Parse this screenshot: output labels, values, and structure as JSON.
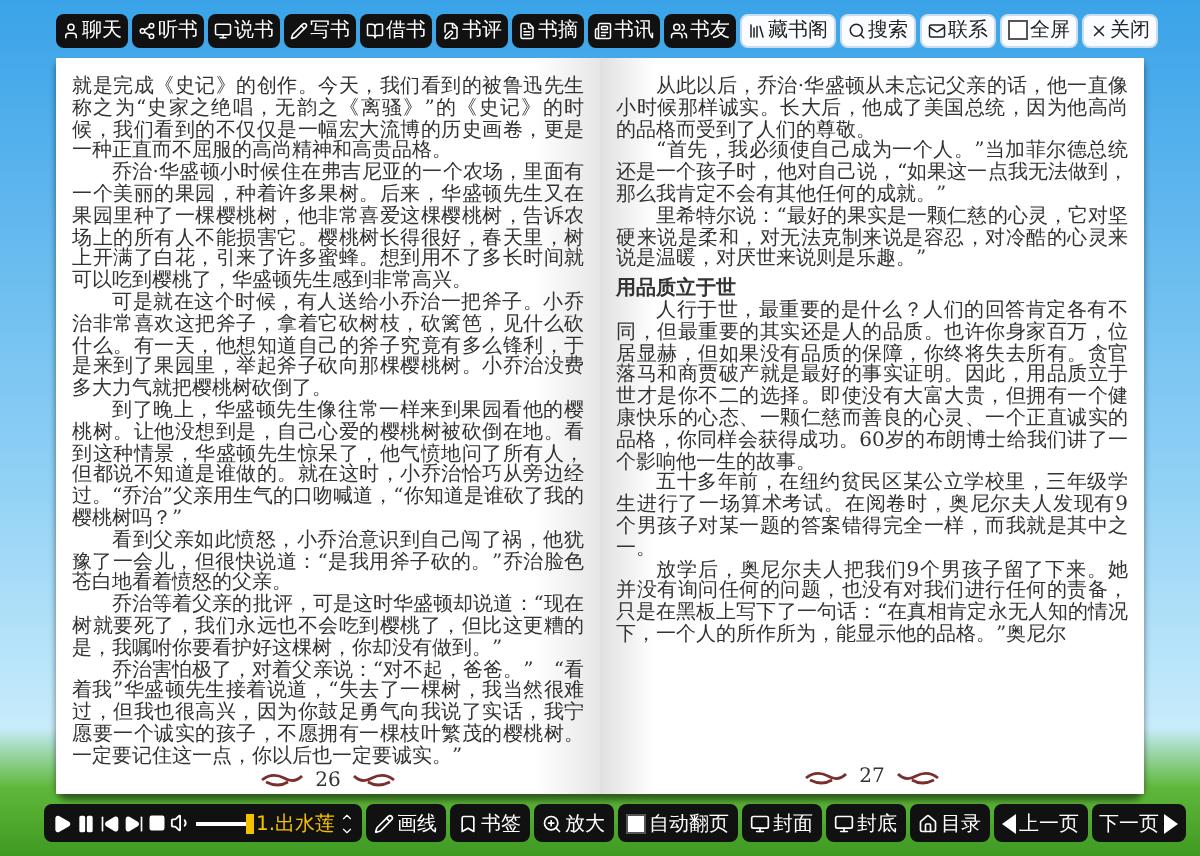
{
  "top_toolbar": {
    "dark_buttons": [
      {
        "label": "聊天"
      },
      {
        "label": "听书"
      },
      {
        "label": "说书"
      },
      {
        "label": "写书"
      },
      {
        "label": "借书"
      },
      {
        "label": "书评"
      },
      {
        "label": "书摘"
      },
      {
        "label": "书讯"
      },
      {
        "label": "书友"
      }
    ],
    "light_buttons": [
      {
        "label": "藏书阁",
        "kind": "button"
      },
      {
        "label": "搜索",
        "kind": "button"
      },
      {
        "label": "联系",
        "kind": "button"
      },
      {
        "label": "全屏",
        "kind": "checkbox",
        "checked": false
      },
      {
        "label": "关闭",
        "kind": "button"
      }
    ]
  },
  "book": {
    "pages": [
      {
        "page_number": "26",
        "paragraphs": [
          {
            "kind": "continuation",
            "text": "就是完成《史记》的创作。今天，我们看到的被鲁迅先生称之为“史家之绝唱，无韵之《离骚》”的《史记》的时候，我们看到的不仅仅是一幅宏大流博的历史画卷，更是一种正直而不屈服的高尚精神和高贵品格。"
          },
          {
            "kind": "body",
            "text": "乔治·华盛顿小时候住在弗吉尼亚的一个农场，里面有一个美丽的果园，种着许多果树。后来，华盛顿先生又在果园里种了一棵樱桃树，他非常喜爱这棵樱桃树，告诉农场上的所有人不能损害它。樱桃树长得很好，春天里，树上开满了白花，引来了许多蜜蜂。想到用不了多长时间就可以吃到樱桃了，华盛顿先生感到非常高兴。"
          },
          {
            "kind": "body",
            "text": "可是就在这个时候，有人送给小乔治一把斧子。小乔治非常喜欢这把斧子，拿着它砍树枝，砍篱笆，见什么砍什么。有一天，他想知道自己的斧子究竟有多么锋利，于是来到了果园里，举起斧子砍向那棵樱桃树。小乔治没费多大力气就把樱桃树砍倒了。"
          },
          {
            "kind": "body",
            "text": "到了晚上，华盛顿先生像往常一样来到果园看他的樱桃树。让他没想到是，自己心爱的樱桃树被砍倒在地。看到这种情景，华盛顿先生惊呆了，他气愤地问了所有人，但都说不知道是谁做的。就在这时，小乔治恰巧从旁边经过。“乔治”父亲用生气的口吻喊道，“你知道是谁砍了我的樱桃树吗？”"
          },
          {
            "kind": "body",
            "text": "看到父亲如此愤怒，小乔治意识到自己闯了祸，他犹豫了一会儿，但很快说道：“是我用斧子砍的。”乔治脸色苍白地看着愤怒的父亲。"
          },
          {
            "kind": "body",
            "text": "乔治等着父亲的批评，可是这时华盛顿却说道：“现在树就要死了，我们永远也不会吃到樱桃了，但比这更糟的是，我嘱咐你要看护好这棵树，你却没有做到。”"
          },
          {
            "kind": "body",
            "text": "乔治害怕极了，对着父亲说：“对不起，爸爸。”　“看着我”华盛顿先生接着说道，“失去了一棵树，我当然很难过，但我也很高兴，因为你鼓足勇气向我说了实话，我宁愿要一个诚实的孩子，不愿拥有一棵枝叶繁茂的樱桃树。一定要记住这一点，你以后也一定要诚实。”"
          }
        ]
      },
      {
        "page_number": "27",
        "paragraphs": [
          {
            "kind": "body",
            "text": "从此以后，乔治·华盛顿从未忘记父亲的话，他一直像小时候那样诚实。长大后，他成了美国总统，因为他高尚的品格而受到了人们的尊敬。"
          },
          {
            "kind": "body",
            "text": "“首先，我必须使自己成为一个人。”当加菲尔德总统还是一个孩子时，他对自己说，“如果这一点我无法做到，那么我肯定不会有其他任何的成就。”"
          },
          {
            "kind": "body",
            "text": "里希特尔说：“最好的果实是一颗仁慈的心灵，它对坚硬来说是柔和，对无法克制来说是容忍，对冷酷的心灵来说是温暖，对厌世来说则是乐趣。”"
          },
          {
            "kind": "heading",
            "text": "用品质立于世"
          },
          {
            "kind": "body",
            "text": "人行于世，最重要的是什么？人们的回答肯定各有不同，但最重要的其实还是人的品质。也许你身家百万，位居显赫，但如果没有品质的保障，你终将失去所有。贪官落马和商贾破产就是最好的事实证明。因此，用品质立于世才是你不二的选择。即使没有大富大贵，但拥有一个健康快乐的心态、一颗仁慈而善良的心灵、一个正直诚实的品格，你同样会获得成功。60岁的布朗博士给我们讲了一个影响他一生的故事。"
          },
          {
            "kind": "body",
            "text": "五十多年前，在纽约贫民区某公立学校里，三年级学生进行了一场算术考试。在阅卷时，奥尼尔夫人发现有9个男孩子对某一题的答案错得完全一样，而我就是其中之一。"
          },
          {
            "kind": "body",
            "text": "放学后，奥尼尔夫人把我们9个男孩子留了下来。她并没有询问任何的问题，也没有对我们进行任何的责备，只是在黑板上写下了一句话：“在真相肯定永无人知的情况下，一个人的所作所为，能显示他的品格。”奥尼尔"
          }
        ]
      }
    ]
  },
  "bottom_toolbar": {
    "volume": {
      "level": 0.95
    },
    "track": "1.出水莲",
    "buttons": [
      {
        "label": "画线"
      },
      {
        "label": "书签"
      },
      {
        "label": "放大"
      },
      {
        "label": "自动翻页",
        "kind": "checkbox",
        "checked": false
      },
      {
        "label": "封面"
      },
      {
        "label": "封底"
      },
      {
        "label": "目录"
      },
      {
        "label": "上一页",
        "kind": "prev"
      },
      {
        "label": "下一页",
        "kind": "next"
      }
    ]
  }
}
